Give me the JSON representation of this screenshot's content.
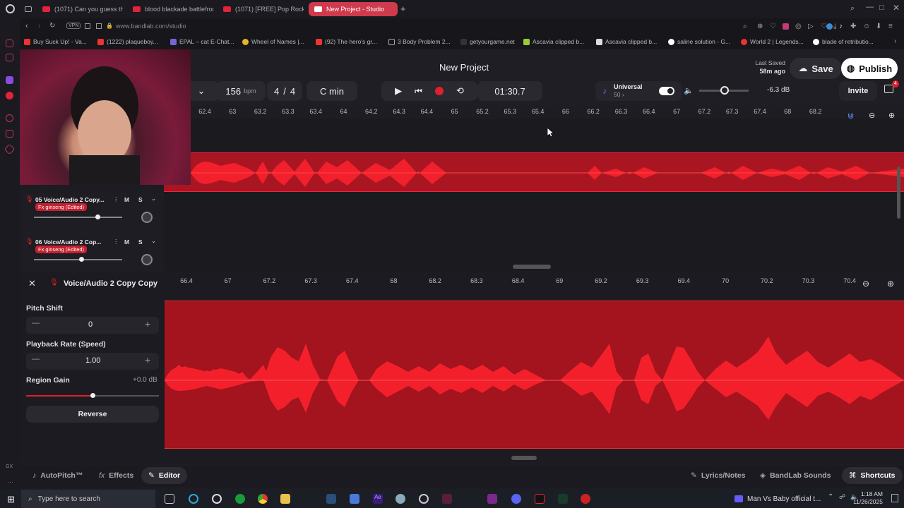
{
  "browser": {
    "tabs": [
      {
        "label": "(1071) Can you guess the"
      },
      {
        "label": "blood blackade battlefron"
      },
      {
        "label": "(1071) [FREE] Pop Rock x"
      },
      {
        "label": "New Project - Studio"
      }
    ],
    "vpn": "VPN",
    "url": "www.bandlab.com/studio",
    "bookmarks": [
      "Buy Suck Up! - Va...",
      "(1222) plaqueboy...",
      "EPAL – cat E-Chat...",
      "Wheel of Names |...",
      "(92) The hero's gr...",
      "3 Body Problem 2...",
      "getyourgame.net",
      "Ascavia clipped b...",
      "Ascavia clipped b...",
      "saline solution - G...",
      "World 2 | Legends...",
      "blade of retributio..."
    ]
  },
  "header": {
    "title": "New Project",
    "last_saved_label": "Last Saved",
    "last_saved_time": "58m ago",
    "save": "Save",
    "publish": "Publish",
    "invite": "Invite",
    "notif_count": "4"
  },
  "transport": {
    "bpm": "156",
    "bpm_unit": "bpm",
    "sig_num": "4",
    "sig_sep": "/",
    "sig_den": "4",
    "key": "C min",
    "time": "01:30.7",
    "universal_label": "Universal",
    "universal_value": "50 ›",
    "volume_db": "-6.3 dB"
  },
  "ruler_top": [
    "62.4",
    "63",
    "63.2",
    "63.3",
    "63.4",
    "64",
    "64.2",
    "64.3",
    "64.4",
    "65",
    "65.2",
    "65.3",
    "65.4",
    "66",
    "66.2",
    "66.3",
    "66.4",
    "67",
    "67.2",
    "67.3",
    "67.4",
    "68",
    "68.2"
  ],
  "tracks": [
    {
      "name": "05  Voice/Audio 2 Copy...",
      "fx": "Fx ginseng (Edited)",
      "m": "M",
      "s": "S",
      "vol": 0.74
    },
    {
      "name": "06  Voice/Audio 2 Cop...",
      "fx": "Fx ginseng (Edited)",
      "m": "M",
      "s": "S",
      "vol": 0.54
    }
  ],
  "editor": {
    "clip_name": "Voice/Audio 2 Copy Copy",
    "pitch_label": "Pitch Shift",
    "pitch_value": "0",
    "rate_label": "Playback Rate (Speed)",
    "rate_value": "1.00",
    "gain_label": "Region Gain",
    "gain_value": "+0.0 dB",
    "gain_level": 0.5,
    "reverse": "Reverse",
    "ruler": [
      "66.4",
      "67",
      "67.2",
      "67.3",
      "67.4",
      "68",
      "68.2",
      "68.3",
      "68.4",
      "69",
      "69.2",
      "69.3",
      "69.4",
      "70",
      "70.2",
      "70.3",
      "70.4"
    ]
  },
  "bottom": {
    "autopitch": "AutoPitch™",
    "effects": "Effects",
    "editor": "Editor",
    "lyrics": "Lyrics/Notes",
    "sounds": "BandLab Sounds",
    "shortcuts": "Shortcuts"
  },
  "taskbar": {
    "search": "Type here to search",
    "media": "Man Vs Baby official t...",
    "time": "1:18 AM",
    "date": "11/26/2025"
  }
}
